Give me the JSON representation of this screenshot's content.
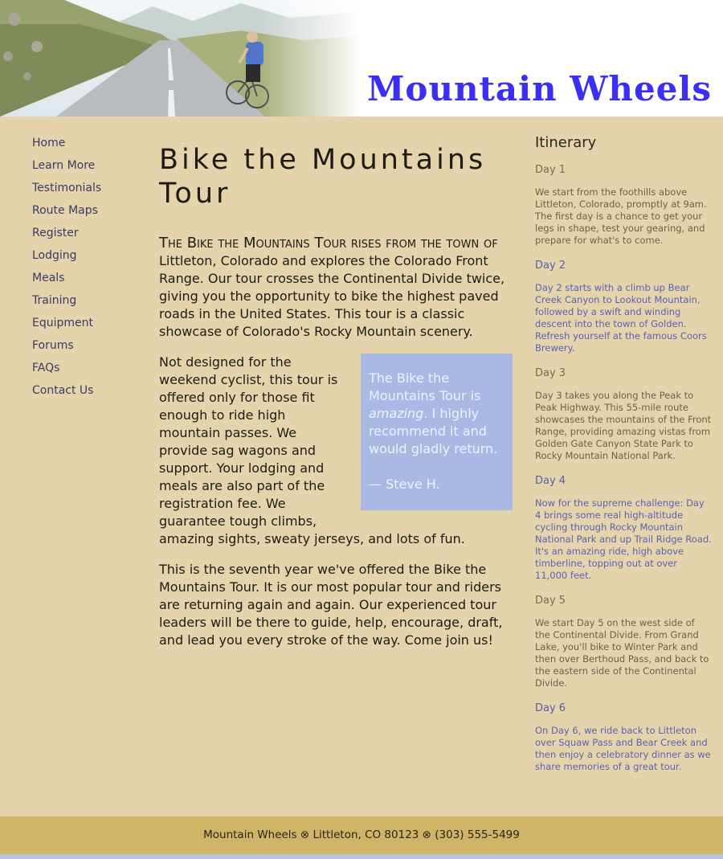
{
  "header": {
    "site_title": "Mountain Wheels"
  },
  "nav": {
    "items": [
      "Home",
      "Learn More",
      "Testimonials",
      "Route Maps",
      "Register",
      "Lodging",
      "Meals",
      "Training",
      "Equipment",
      "Forums",
      "FAQs",
      "Contact Us"
    ]
  },
  "main": {
    "title": "Bike the Mountains Tour",
    "intro_lead": "The Bike the Mountains Tour rises from the town of",
    "intro_rest": "Littleton, Colorado and explores the Colorado Front Range. Our tour crosses the Continental Divide twice, giving you the opportunity to bike the highest paved roads in the United States. This tour is a classic showcase of Colorado's Rocky Mountain scenery.",
    "para2": "Not designed for the weekend cyclist, this tour is offered only for those fit enough to ride high mountain passes. We provide sag wagons and support. Your lodging and meals are also part of the registration fee. We guarantee tough climbs, amazing sights, sweaty jerseys, and lots of fun.",
    "para3": "This is the seventh year we've offered the Bike the Mountains Tour. It is our most popular tour and riders are returning again and again. Our experienced tour leaders will be there to guide, help, encourage, draft, and lead you every stroke of the way. Come join us!",
    "quote": {
      "before": "The Bike the Mountains Tour is",
      "emphasis": "amazing",
      "after": ". I highly recommend it and would gladly return.",
      "author": "— Steve H."
    }
  },
  "itinerary": {
    "title": "Itinerary",
    "days": [
      {
        "label": "Day 1",
        "text": "We start from the foothills above Littleton, Colorado, promptly at 9am. The first day is a chance to get your legs in shape, test your gearing, and prepare for what's to come."
      },
      {
        "label": "Day 2",
        "text": "Day 2 starts with a climb up Bear Creek Canyon to Lookout Mountain, followed by a swift and winding descent into the town of Golden. Refresh yourself at the famous Coors Brewery."
      },
      {
        "label": "Day 3",
        "text": "Day 3 takes you along the Peak to Peak Highway. This 55-mile route showcases the mountains of the Front Range, providing amazing vistas from Golden Gate Canyon State Park to Rocky Mountain National Park."
      },
      {
        "label": "Day 4",
        "text": "Now for the supreme challenge: Day 4 brings some real high-altitude cycling through Rocky Mountain National Park and up Trail Ridge Road. It's an amazing ride, high above timberline, topping out at over 11,000 feet."
      },
      {
        "label": "Day 5",
        "text": "We start Day 5 on the west side of the Continental Divide. From Grand Lake, you'll bike to Winter Park and then over Berthoud Pass, and back to the eastern side of the Continental Divide."
      },
      {
        "label": "Day 6",
        "text": "On Day 6, we ride back to Littleton over Squaw Pass and Bear Creek and then enjoy a celebratory dinner as we share memories of a great tour."
      }
    ]
  },
  "footer": {
    "text": "Mountain Wheels ⊗ Littleton, CO 80123 ⊗ (303) 555-5499"
  }
}
